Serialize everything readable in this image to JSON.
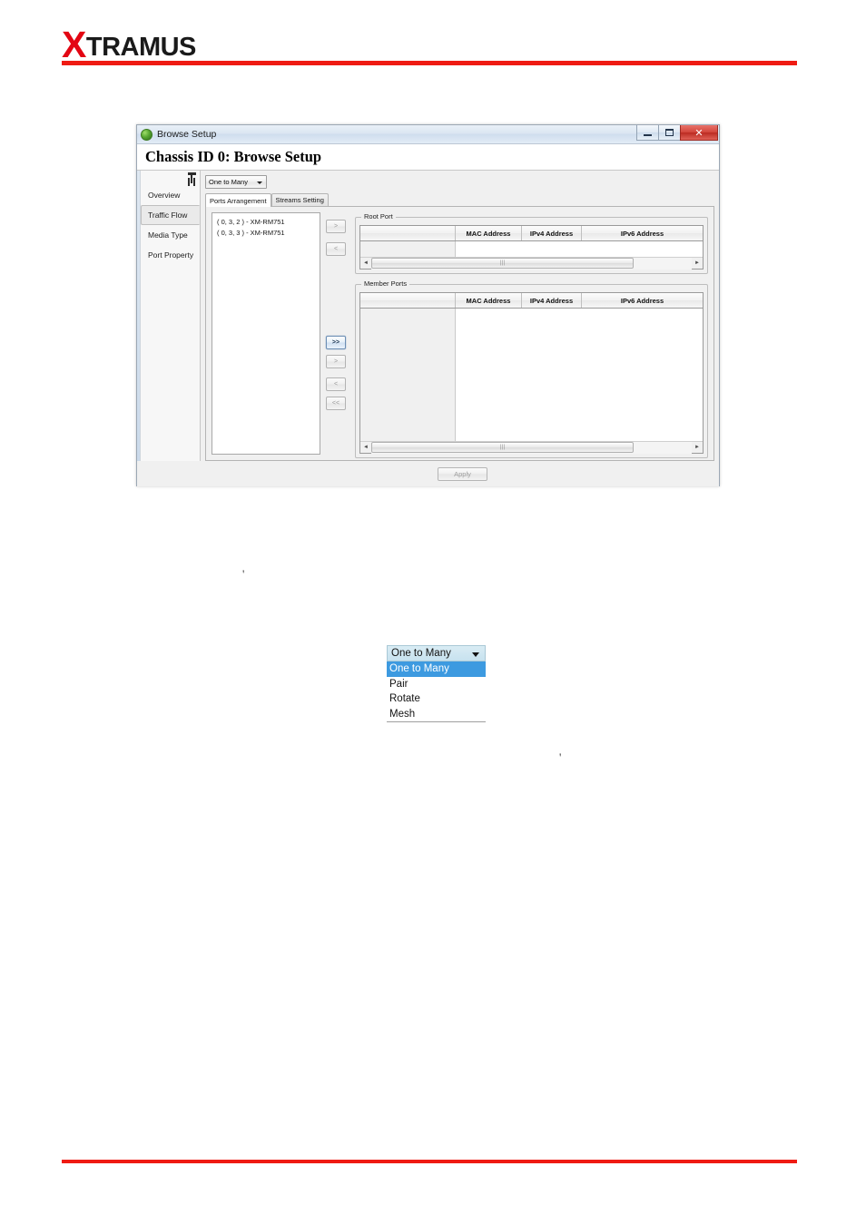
{
  "brand": {
    "initial": "X",
    "rest": "TRAMUS"
  },
  "window": {
    "titlebar_title": "Browse Setup",
    "titlebar_icon": "globe-icon",
    "minimize_label": "",
    "maximize_label": "",
    "close_label": "✕",
    "header_title": "Chassis ID 0: Browse Setup"
  },
  "sidebar": {
    "pin_icon": "pushpin-icon",
    "items": [
      {
        "label": "Overview",
        "selected": false
      },
      {
        "label": "Traffic Flow",
        "selected": true
      },
      {
        "label": "Media Type",
        "selected": false
      },
      {
        "label": "Port Property",
        "selected": false
      }
    ]
  },
  "content": {
    "mode_select_value": "One to Many",
    "tabs": [
      {
        "label": "Ports Arrangement",
        "active": true
      },
      {
        "label": "Streams Setting",
        "active": false
      }
    ],
    "ports_list": [
      "( 0, 3, 2 ) - XM-RM751",
      "( 0, 3, 3 ) - XM-RM751"
    ],
    "transfer_buttons": [
      {
        "label": ">",
        "enabled": false,
        "name": "root-add-button"
      },
      {
        "label": "<",
        "enabled": false,
        "name": "root-remove-button"
      },
      {
        "label": ">>",
        "enabled": true,
        "name": "member-add-all-button"
      },
      {
        "label": ">",
        "enabled": false,
        "name": "member-add-button"
      },
      {
        "label": "<",
        "enabled": false,
        "name": "member-remove-button"
      },
      {
        "label": "<<",
        "enabled": false,
        "name": "member-remove-all-button"
      }
    ],
    "root_port": {
      "legend": "Root Port",
      "columns": [
        "",
        "MAC Address",
        "IPv4 Address",
        "IPv6 Address"
      ],
      "rows": []
    },
    "member_ports": {
      "legend": "Member Ports",
      "columns": [
        "",
        "MAC Address",
        "IPv4 Address",
        "IPv6 Address"
      ],
      "rows": []
    },
    "scrollbar": {
      "left_arrow": "◄",
      "right_arrow": "►",
      "grip": "|||"
    },
    "apply_label": "Apply"
  },
  "dropdown": {
    "selected": "One to Many",
    "options": [
      {
        "label": "One to Many",
        "selected": true
      },
      {
        "label": "Pair",
        "selected": false
      },
      {
        "label": "Rotate",
        "selected": false
      },
      {
        "label": "Mesh",
        "selected": false
      }
    ]
  },
  "marks": {
    "mark_1": "'",
    "mark_2": "'"
  }
}
